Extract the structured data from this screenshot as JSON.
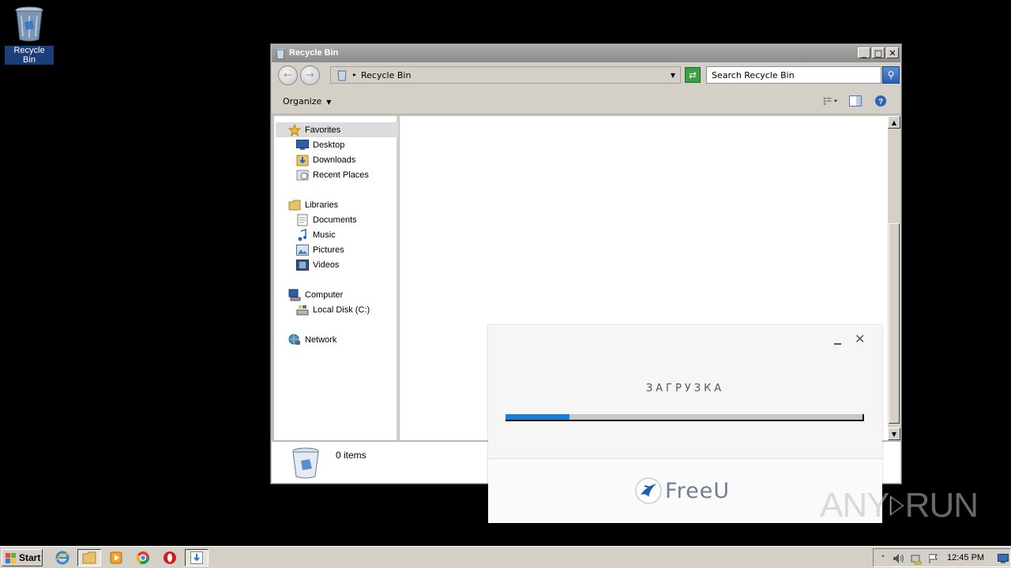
{
  "desktop": {
    "icons": [
      {
        "label": "Recycle Bin"
      }
    ]
  },
  "window": {
    "title": "Recycle Bin",
    "address": "Recycle Bin",
    "search_placeholder": "Search Recycle Bin",
    "organize_label": "Organize",
    "nav": {
      "favorites": {
        "label": "Favorites",
        "items": [
          "Desktop",
          "Downloads",
          "Recent Places"
        ]
      },
      "libraries": {
        "label": "Libraries",
        "items": [
          "Documents",
          "Music",
          "Pictures",
          "Videos"
        ]
      },
      "computer": {
        "label": "Computer",
        "items": [
          "Local Disk (C:)"
        ]
      },
      "network": {
        "label": "Network"
      }
    },
    "details": {
      "count_text": "0 items"
    }
  },
  "dialog": {
    "title": "ЗАГРУЗКА",
    "progress": 0.18,
    "brand": "FreeU",
    "accent": "#1a7fd6"
  },
  "watermark": {
    "left": "ANY",
    "right": "RUN"
  },
  "taskbar": {
    "start_label": "Start",
    "apps": [
      "ie-icon",
      "explorer-icon",
      "media-player-icon",
      "chrome-icon",
      "opera-icon",
      "downloader-icon"
    ],
    "clock": "12:45 PM"
  }
}
